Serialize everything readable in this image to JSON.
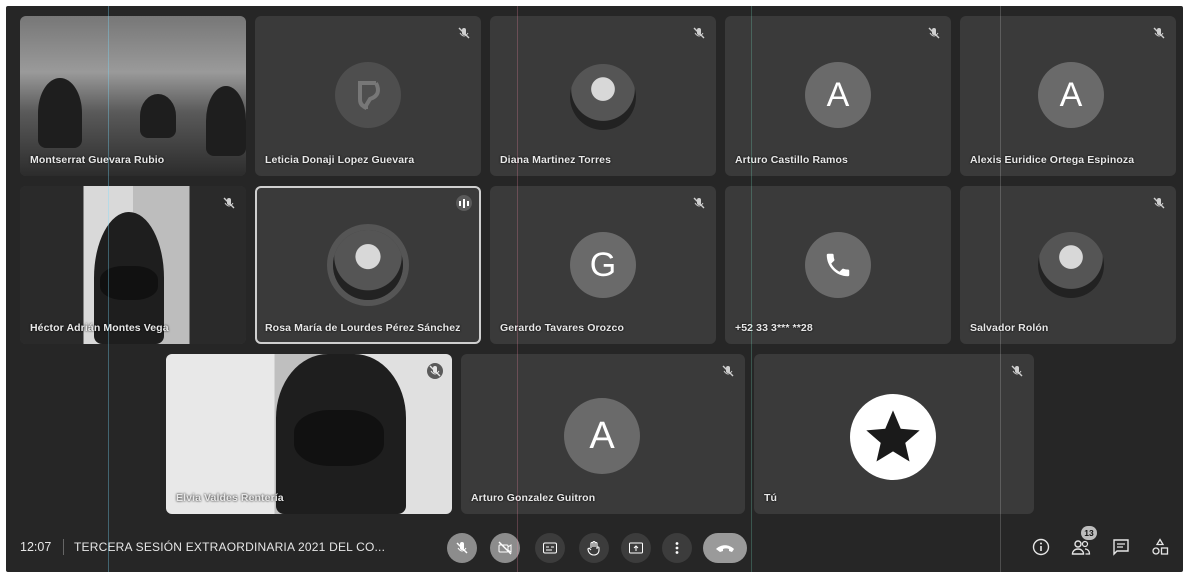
{
  "participants": [
    {
      "name": "Montserrat Guevara Rubio"
    },
    {
      "name": "Leticia Donaji Lopez Guevara"
    },
    {
      "name": "Diana Martinez Torres"
    },
    {
      "name": "Arturo Castillo Ramos",
      "initial": "A"
    },
    {
      "name": "Alexis Euridice Ortega Espinoza",
      "initial": "A"
    },
    {
      "name": "Héctor Adrián Montes Vega"
    },
    {
      "name": "Rosa María de Lourdes Pérez Sánchez"
    },
    {
      "name": "Gerardo Tavares Orozco",
      "initial": "G"
    },
    {
      "name": "+52 33 3*** **28"
    },
    {
      "name": "Salvador Rolón"
    },
    {
      "name": "Elvia Valdes Rentería"
    },
    {
      "name": "Arturo Gonzalez Guitron",
      "initial": "A"
    },
    {
      "name": "Tú"
    }
  ],
  "bottom_bar": {
    "time": "12:07",
    "meeting_title": "TERCERA SESIÓN EXTRAORDINARIA 2021 DEL CO...",
    "people_count": "13"
  },
  "colors": {
    "background": "#262626",
    "tile": "#3a3a3a",
    "avatar": "#6a6a6a",
    "hangup": "#9a9a9a"
  }
}
